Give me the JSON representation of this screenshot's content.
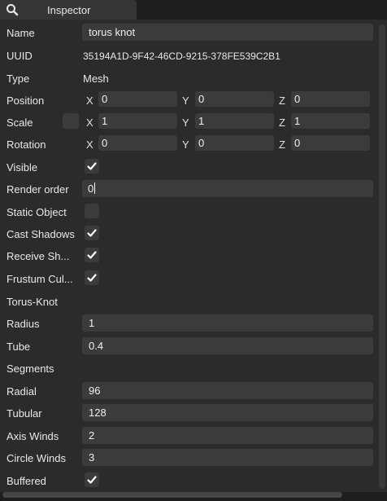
{
  "tab": {
    "title": "Inspector",
    "icon": "search-icon"
  },
  "fields": {
    "name": {
      "label": "Name",
      "value": "torus knot"
    },
    "uuid": {
      "label": "UUID",
      "value": "35194A1D-9F42-46CD-9215-378FE539C2B1"
    },
    "type": {
      "label": "Type",
      "value": "Mesh"
    },
    "position": {
      "label": "Position",
      "x": "0",
      "y": "0",
      "z": "0"
    },
    "scale": {
      "label": "Scale",
      "x": "1",
      "y": "1",
      "z": "1"
    },
    "rotation": {
      "label": "Rotation",
      "x": "0",
      "y": "0",
      "z": "0"
    },
    "visible": {
      "label": "Visible",
      "checked": true
    },
    "render_order": {
      "label": "Render order",
      "value": "0"
    },
    "static_object": {
      "label": "Static Object",
      "checked": false
    },
    "cast_shadows": {
      "label": "Cast Shadows",
      "checked": true
    },
    "receive_shadows": {
      "label": "Receive Sh...",
      "checked": true
    },
    "frustum_culled": {
      "label": "Frustum Cul...",
      "checked": true
    }
  },
  "axis_labels": {
    "x": "X",
    "y": "Y",
    "z": "Z"
  },
  "geometry": {
    "section": "Torus-Knot",
    "radius": {
      "label": "Radius",
      "value": "1"
    },
    "tube": {
      "label": "Tube",
      "value": "0.4"
    },
    "segments_section": "Segments",
    "radial": {
      "label": "Radial",
      "value": "96"
    },
    "tubular": {
      "label": "Tubular",
      "value": "128"
    },
    "axis_winds": {
      "label": "Axis Winds",
      "value": "2"
    },
    "circle_winds": {
      "label": "Circle Winds",
      "value": "3"
    },
    "buffered": {
      "label": "Buffered",
      "checked": true
    }
  }
}
